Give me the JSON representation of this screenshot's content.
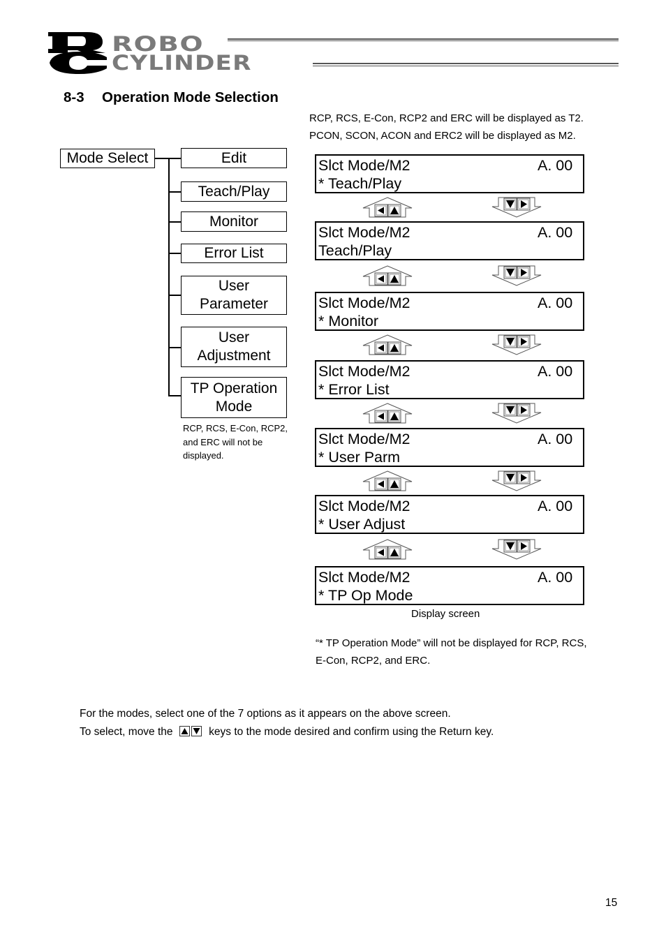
{
  "header": {
    "logo_mark": "RC",
    "logo_line1": "ROBO",
    "logo_line2": "CYLINDER"
  },
  "section": {
    "number": "8-3",
    "title": "Operation Mode Selection"
  },
  "notes": {
    "top_line1": "RCP, RCS, E-Con, RCP2 and ERC will be displayed as T2.",
    "top_line2": "PCON, SCON, ACON and ERC2 will be displayed as M2.",
    "tree_note_line1": "RCP, RCS, E-Con, RCP2,",
    "tree_note_line2": "and ERC will not be",
    "tree_note_line3": "displayed.",
    "bottom_line1": "“* TP Operation Mode” will not be displayed for RCP, RCS,",
    "bottom_line2": "E-Con, RCP2, and ERC."
  },
  "tree": {
    "root": "Mode Select",
    "items": [
      {
        "line1": "Edit",
        "line2": ""
      },
      {
        "line1": "Teach/Play",
        "line2": ""
      },
      {
        "line1": "Monitor",
        "line2": ""
      },
      {
        "line1": "Error List",
        "line2": ""
      },
      {
        "line1": "User",
        "line2": "Parameter"
      },
      {
        "line1": "User",
        "line2": "Adjustment"
      },
      {
        "line1": "TP Operation",
        "line2": "Mode"
      }
    ]
  },
  "display": {
    "caption": "Display screen",
    "screens": [
      {
        "title": "Slct Mode/M2",
        "address": "A. 00",
        "mode": "* Teach/Play"
      },
      {
        "title": "Slct Mode/M2",
        "address": "A. 00",
        "mode": "Teach/Play"
      },
      {
        "title": "Slct Mode/M2",
        "address": "A. 00",
        "mode": "* Monitor"
      },
      {
        "title": "Slct Mode/M2",
        "address": "A. 00",
        "mode": "* Error List"
      },
      {
        "title": "Slct Mode/M2",
        "address": "A. 00",
        "mode": "* User Parm"
      },
      {
        "title": "Slct Mode/M2",
        "address": "A. 00",
        "mode": "* User Adjust"
      },
      {
        "title": "Slct Mode/M2",
        "address": "A. 00",
        "mode": "* TP Op Mode"
      }
    ],
    "up_keys_icon": "left-up-keys-arrow-icon",
    "down_keys_icon": "down-right-keys-arrow-icon"
  },
  "body": {
    "line1": "For the modes, select one of the 7 options as it appears on the above screen.",
    "line2_pre": "To select, move the",
    "line2_post": "keys to the mode desired and confirm using the Return key."
  },
  "page_number": "15"
}
